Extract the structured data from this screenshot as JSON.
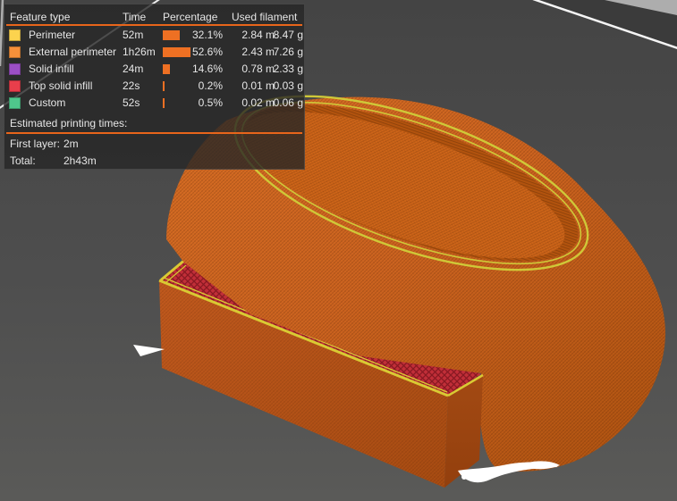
{
  "panel": {
    "columns": {
      "feature_type": "Feature type",
      "time": "Time",
      "percentage": "Percentage",
      "used_filament": "Used filament"
    },
    "rows": [
      {
        "feature": "Perimeter",
        "color": "#FCD34E",
        "time": "52m",
        "percent": "32.1%",
        "percent_value": 32.1,
        "length": "2.84 m",
        "weight": "8.47 g"
      },
      {
        "feature": "External perimeter",
        "color": "#F6903A",
        "time": "1h26m",
        "percent": "52.6%",
        "percent_value": 52.6,
        "length": "2.43 m",
        "weight": "7.26 g"
      },
      {
        "feature": "Solid infill",
        "color": "#9C4FC6",
        "time": "24m",
        "percent": "14.6%",
        "percent_value": 14.6,
        "length": "0.78 m",
        "weight": "2.33 g"
      },
      {
        "feature": "Top solid infill",
        "color": "#E83E4B",
        "time": "22s",
        "percent": "0.2%",
        "percent_value": 0.2,
        "length": "0.01 m",
        "weight": "0.03 g"
      },
      {
        "feature": "Custom",
        "color": "#4FC78C",
        "time": "52s",
        "percent": "0.5%",
        "percent_value": 0.5,
        "length": "0.02 m",
        "weight": "0.06 g"
      }
    ],
    "estimated_title": "Estimated printing times:",
    "first_layer_label": "First layer:",
    "first_layer_value": "2m",
    "total_label": "Total:",
    "total_value": "2h43m",
    "accent_color": "#E8651B",
    "bar_color": "#EE7023"
  },
  "scene": {
    "background_top": "#454545",
    "background_bottom": "#5A5A58",
    "model_color": "#CE6420",
    "perimeter_color": "#CFC838",
    "top_infill_color": "#C12E38",
    "edge_stripe_color": "#D9CA33",
    "bed_line_color": "#FFFFFF"
  }
}
